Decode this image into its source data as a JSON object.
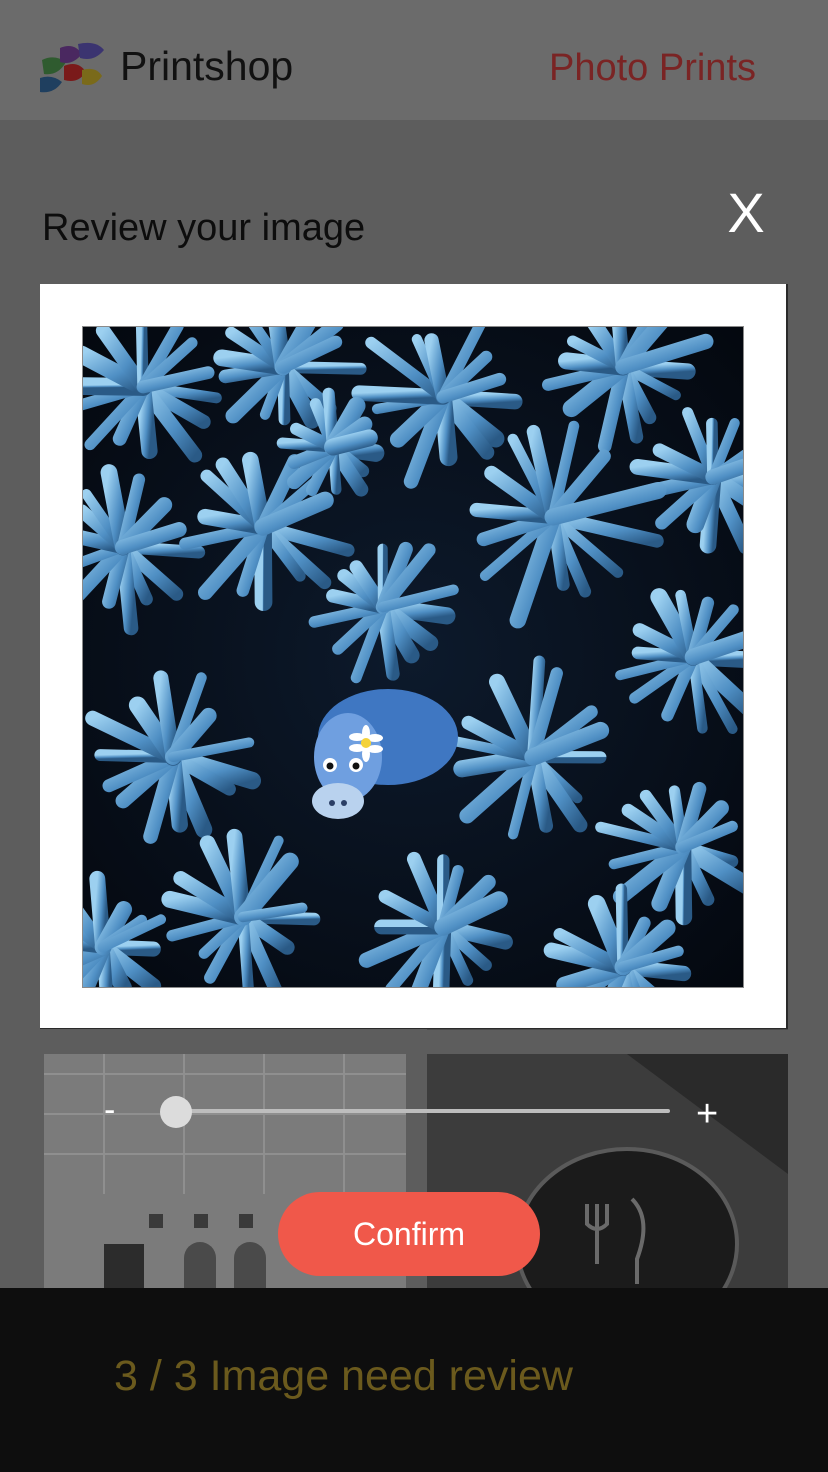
{
  "header": {
    "brand": "Printshop",
    "link": "Photo Prints",
    "logo_icon": "printshop-logo-icon"
  },
  "modal": {
    "title": "Review your image",
    "close_label": "X",
    "image_icon": "photo-blue-succulent-with-plush-toy",
    "zoom": {
      "minus_label": "-",
      "plus_label": "+",
      "level": 0.0
    },
    "confirm_label": "Confirm"
  },
  "footer": {
    "status": "3 / 3 Image need review"
  },
  "colors": {
    "accent": "#f0584a",
    "header_link": "#7a2424",
    "footer_text": "#6b5a1d",
    "footer_bg": "#0e0e0e"
  }
}
